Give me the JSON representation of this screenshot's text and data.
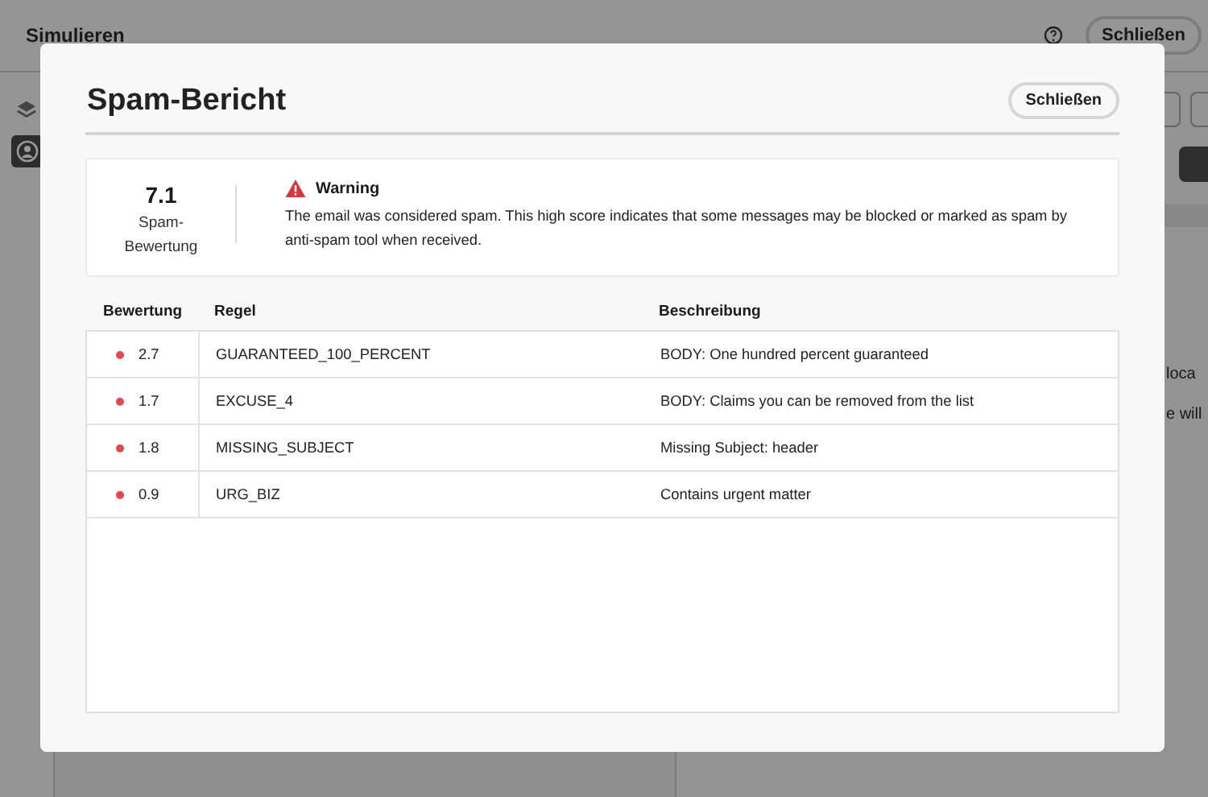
{
  "page": {
    "title": "Simulieren",
    "close_button": "Schließen",
    "fragments": [
      "loca",
      "e will"
    ]
  },
  "dialog": {
    "title": "Spam-Bericht",
    "close_button": "Schließen",
    "summary": {
      "score": "7.1",
      "score_label": "Spam-Bewertung",
      "warning_title": "Warning",
      "warning_text": "The email was considered spam. This high score indicates that some messages may be blocked or marked as spam by anti-spam tool when received."
    },
    "table": {
      "columns": [
        "Bewertung",
        "Regel",
        "Beschreibung"
      ],
      "rows": [
        {
          "score": "2.7",
          "rule": "GUARANTEED_100_PERCENT",
          "description": "BODY: One hundred percent guaranteed",
          "color": "#e34850"
        },
        {
          "score": "1.7",
          "rule": "EXCUSE_4",
          "description": "BODY: Claims you can be removed from the list",
          "color": "#e34850"
        },
        {
          "score": "1.8",
          "rule": "MISSING_SUBJECT",
          "description": "Missing Subject: header",
          "color": "#e34850"
        },
        {
          "score": "0.9",
          "rule": "URG_BIZ",
          "description": "Contains urgent matter",
          "color": "#e34850"
        }
      ]
    }
  }
}
